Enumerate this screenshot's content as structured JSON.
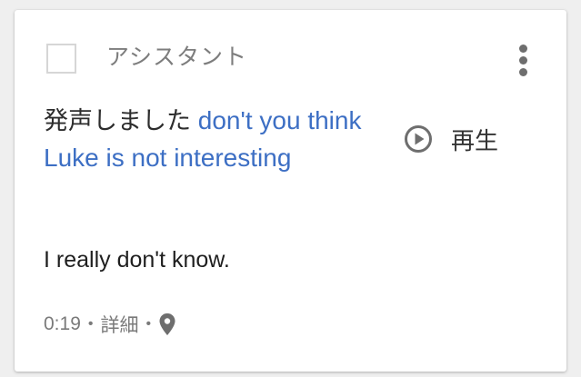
{
  "card": {
    "app_label": "アシスタント",
    "utterance_prefix": "発声しました",
    "query": "don't you think Luke is not interesting",
    "play_label": "再生",
    "response": "I really don't know.",
    "time": "0:19",
    "separator": "•",
    "details_link": "詳細"
  },
  "icons": {
    "menu": "more-vertical-icon",
    "play": "play-circle-icon",
    "location": "location-pin-icon"
  },
  "colors": {
    "query_link": "#3d6fc4",
    "secondary_text": "#7a7a7a"
  }
}
